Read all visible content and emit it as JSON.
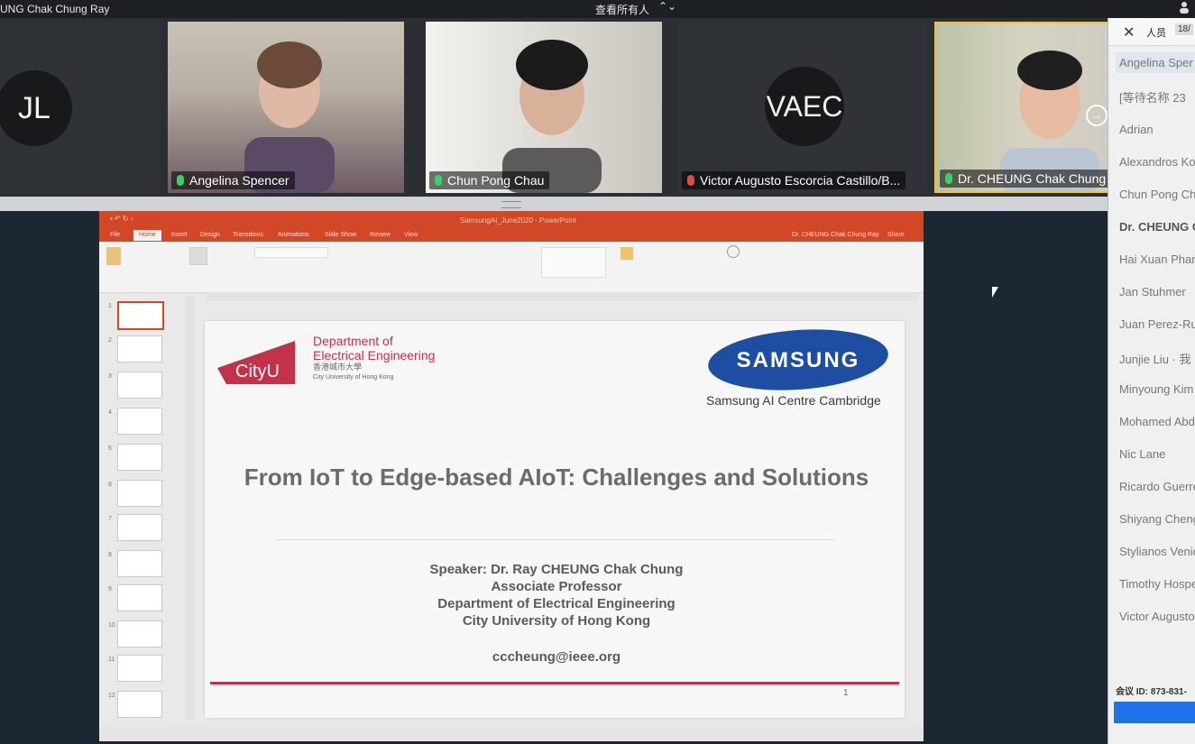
{
  "topbar": {
    "presenter": "UNG Chak Chung Ray",
    "view_all": "查看所有人"
  },
  "video_tiles": [
    {
      "initials": "JL"
    },
    {
      "name": "Angelina Spencer"
    },
    {
      "name": "Chun Pong Chau"
    },
    {
      "initials": "VAEC",
      "name": "Victor Augusto Escorcia Castillo/B..."
    },
    {
      "name": "Dr. CHEUNG Chak Chung"
    }
  ],
  "participants_panel": {
    "title": "人员",
    "count": "18/",
    "items": [
      "Angelina Sper",
      "[等待名称 23",
      "Adrian",
      "Alexandros Ko",
      "Chun Pong Ch",
      "Dr. CHEUNG C",
      "Hai Xuan Pham",
      "Jan Stuhmer",
      "Juan Perez-Rua",
      "Junjie Liu · 我",
      "Minyoung Kim",
      "Mohamed Abd",
      "Nic Lane",
      "Ricardo Guerre",
      "Shiyang Cheng",
      "Stylianos Venie",
      "Timothy Hospe",
      "Victor Augusto"
    ],
    "meeting_id": "会议 ID: 873-831-"
  },
  "powerpoint": {
    "doc_title": "SamsungAI_June2020 - PowerPoint",
    "tabs": [
      "File",
      "Home",
      "Insert",
      "Design",
      "Transitions",
      "Animations",
      "Slide Show",
      "Review",
      "View"
    ],
    "active_tab": "Home",
    "user": "Dr. CHEUNG Chak Chung Ray",
    "share": "Share",
    "thumbnail_numbers": [
      "1",
      "2",
      "3",
      "4",
      "5",
      "6",
      "7",
      "8",
      "9",
      "10",
      "11",
      "12"
    ]
  },
  "slide": {
    "dept_line1": "Department of",
    "dept_line2": "Electrical Engineering",
    "cityu_cn": "香港城市大學",
    "cityu_en": "City University of Hong Kong",
    "cityu_logo": "CityU",
    "samsung": "SAMSUNG",
    "samsung_sub": "Samsung AI Centre Cambridge",
    "title": "From IoT to Edge-based AIoT: Challenges and Solutions",
    "speaker": "Speaker: Dr. Ray CHEUNG Chak Chung",
    "role": "Associate Professor",
    "department": "Department of Electrical Engineering",
    "university": "City University of Hong Kong",
    "email": "cccheung@ieee.org",
    "page_number": "1"
  }
}
